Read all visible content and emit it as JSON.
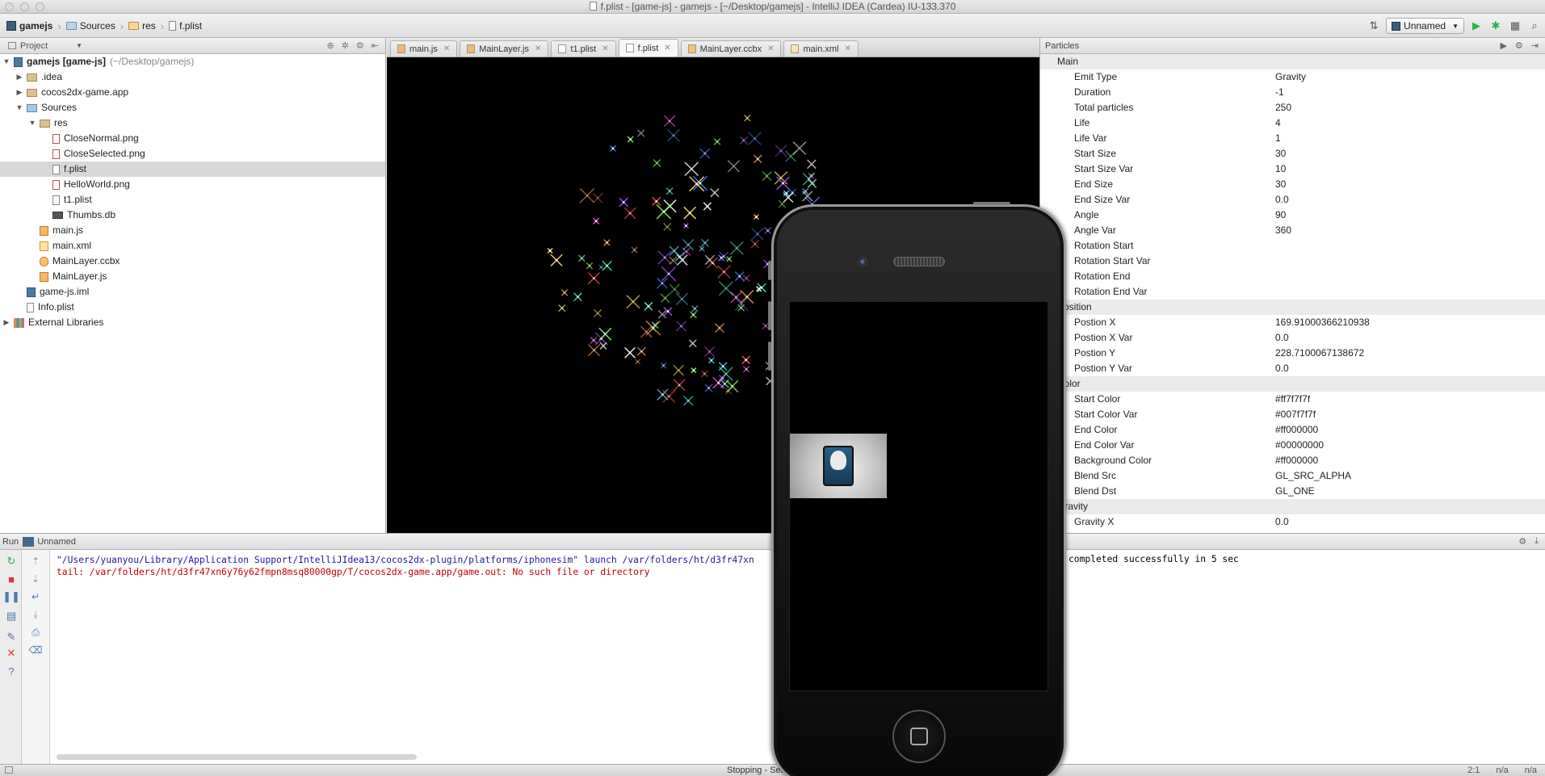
{
  "window": {
    "title": "f.plist - [game-js] - gamejs - [~/Desktop/gamejs] - IntelliJ IDEA (Cardea) IU-133.370"
  },
  "breadcrumbs": [
    "gamejs",
    "Sources",
    "res",
    "f.plist"
  ],
  "run_config": {
    "label": "Unnamed"
  },
  "project_panel": {
    "title": "Project",
    "tree": [
      {
        "label": "gamejs [game-js]",
        "suffix": "(~/Desktop/gamejs)",
        "depth": 0,
        "icon": "project",
        "arrow": "open"
      },
      {
        "label": ".idea",
        "depth": 1,
        "icon": "folder",
        "arrow": "closed"
      },
      {
        "label": "cocos2dx-game.app",
        "depth": 1,
        "icon": "folder",
        "arrow": "closed"
      },
      {
        "label": "Sources",
        "depth": 1,
        "icon": "folder-blue",
        "arrow": "open"
      },
      {
        "label": "res",
        "depth": 2,
        "icon": "folder",
        "arrow": "open"
      },
      {
        "label": "CloseNormal.png",
        "depth": 3,
        "icon": "png"
      },
      {
        "label": "CloseSelected.png",
        "depth": 3,
        "icon": "png"
      },
      {
        "label": "f.plist",
        "depth": 3,
        "icon": "plist",
        "selected": true
      },
      {
        "label": "HelloWorld.png",
        "depth": 3,
        "icon": "png"
      },
      {
        "label": "t1.plist",
        "depth": 3,
        "icon": "plist"
      },
      {
        "label": "Thumbs.db",
        "depth": 3,
        "icon": "db"
      },
      {
        "label": "main.js",
        "depth": 2,
        "icon": "js"
      },
      {
        "label": "main.xml",
        "depth": 2,
        "icon": "xml"
      },
      {
        "label": "MainLayer.ccbx",
        "depth": 2,
        "icon": "ccbx"
      },
      {
        "label": "MainLayer.js",
        "depth": 2,
        "icon": "js"
      },
      {
        "label": "game-js.iml",
        "depth": 1,
        "icon": "iml"
      },
      {
        "label": "Info.plist",
        "depth": 1,
        "icon": "plist"
      },
      {
        "label": "External Libraries",
        "depth": 0,
        "icon": "lib",
        "arrow": "closed"
      }
    ]
  },
  "editor_tabs": [
    {
      "label": "main.js",
      "icon": "js"
    },
    {
      "label": "MainLayer.js",
      "icon": "js"
    },
    {
      "label": "t1.plist",
      "icon": "plist"
    },
    {
      "label": "f.plist",
      "icon": "plist",
      "active": true
    },
    {
      "label": "MainLayer.ccbx",
      "icon": "ccbx"
    },
    {
      "label": "main.xml",
      "icon": "xml"
    }
  ],
  "particles_panel": {
    "title": "Particles",
    "groups": [
      {
        "name": "Main",
        "props": [
          [
            "Emit Type",
            "Gravity"
          ],
          [
            "Duration",
            "-1"
          ],
          [
            "Total particles",
            "250"
          ],
          [
            "Life",
            "4"
          ],
          [
            "Life Var",
            "1"
          ],
          [
            "Start Size",
            "30"
          ],
          [
            "Start Size Var",
            "10"
          ],
          [
            "End Size",
            "30"
          ],
          [
            "End Size Var",
            "0.0"
          ],
          [
            "Angle",
            "90"
          ],
          [
            "Angle Var",
            "360"
          ],
          [
            "Rotation Start",
            ""
          ],
          [
            "Rotation Start Var",
            ""
          ],
          [
            "Rotation End",
            ""
          ],
          [
            "Rotation End Var",
            ""
          ]
        ]
      },
      {
        "name": "Position",
        "props": [
          [
            "Postion X",
            "169.91000366210938"
          ],
          [
            "Postion X Var",
            "0.0"
          ],
          [
            "Postion Y",
            "228.7100067138672"
          ],
          [
            "Postion Y Var",
            "0.0"
          ]
        ]
      },
      {
        "name": "Color",
        "props": [
          [
            "Start Color",
            "#ff7f7f7f"
          ],
          [
            "Start Color Var",
            "#007f7f7f"
          ],
          [
            "End Color",
            "#ff000000"
          ],
          [
            "End Color Var",
            "#00000000"
          ],
          [
            "Background Color",
            "#ff000000"
          ],
          [
            "Blend Src",
            "GL_SRC_ALPHA"
          ],
          [
            "Blend Dst",
            "GL_ONE"
          ]
        ]
      },
      {
        "name": "Gravity",
        "props": [
          [
            "Gravity X",
            "0.0"
          ]
        ]
      }
    ]
  },
  "run_panel": {
    "label": "Run",
    "config": "Unnamed",
    "console_lines": [
      {
        "text": "\"/Users/yuanyou/Library/Application Support/IntelliJIdea13/cocos2dx-plugin/platforms/iphonesim\" launch /var/folders/ht/d3fr47xn",
        "color": "blue"
      },
      {
        "text": "tail: /var/folders/ht/d3fr47xn6y76y62fmpn8msq80000gp/T/cocos2dx-game.app/game.out: No such file or directory",
        "color": "red"
      }
    ],
    "console_right": "completed successfully in 5 sec"
  },
  "status_bar": {
    "text": "Stopping - Sea",
    "position": "2:1",
    "col2": "n/a",
    "col3": "n/a"
  },
  "colors": {
    "selection": "#d8d8d8",
    "console_blue": "#1a1aa6",
    "console_red": "#c40000",
    "run_green": "#2bb24c"
  }
}
